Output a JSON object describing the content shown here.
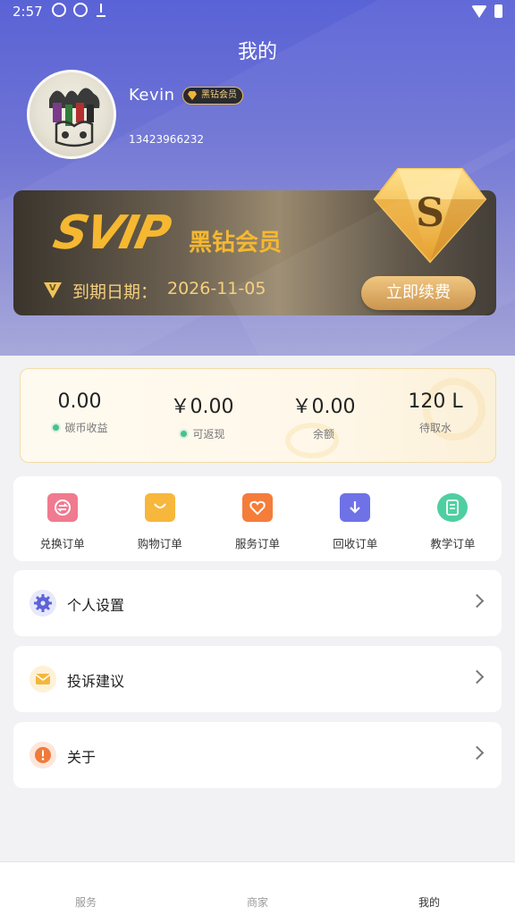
{
  "status_bar": {
    "time": "2:57"
  },
  "header": {
    "title": "我的"
  },
  "profile": {
    "name": "Kevin",
    "badge": "黑钻会员",
    "phone": "13423966232"
  },
  "svip": {
    "logo": "SVIP",
    "name": "黑钻会员",
    "expire_label": "到期日期：",
    "expire_date": "2026-11-05",
    "renew_button": "立即续费",
    "diamond_letter": "S",
    "expire_icon_letter": "V"
  },
  "stats": [
    {
      "value": "0.00",
      "label": "碳币收益",
      "has_icon": true
    },
    {
      "value": "￥0.00",
      "label": "可返现",
      "has_icon": true
    },
    {
      "value": "￥0.00",
      "label": "余额",
      "has_icon": false
    },
    {
      "value": "120 L",
      "label": "待取水",
      "has_icon": false
    }
  ],
  "orders": [
    {
      "label": "兑换订单",
      "icon": "exchange-icon",
      "color": "#f07a8f"
    },
    {
      "label": "购物订单",
      "icon": "shopping-bag-icon",
      "color": "#f6b73c"
    },
    {
      "label": "服务订单",
      "icon": "heart-icon",
      "color": "#f47d3a"
    },
    {
      "label": "回收订单",
      "icon": "recycle-download-icon",
      "color": "#6e72e6"
    },
    {
      "label": "教学订单",
      "icon": "book-icon",
      "color": "#4ecfa2"
    }
  ],
  "menu": [
    {
      "label": "个人设置",
      "icon": "gear-icon",
      "color": "#5b63d8"
    },
    {
      "label": "投诉建议",
      "icon": "envelope-icon",
      "color": "#f4b73b"
    },
    {
      "label": "关于",
      "icon": "info-icon",
      "color": "#f07a3a"
    }
  ],
  "tabbar": {
    "tabs": [
      {
        "label": "服务",
        "active": false
      },
      {
        "label": "商家",
        "active": false
      },
      {
        "label": "我的",
        "active": true
      }
    ]
  }
}
